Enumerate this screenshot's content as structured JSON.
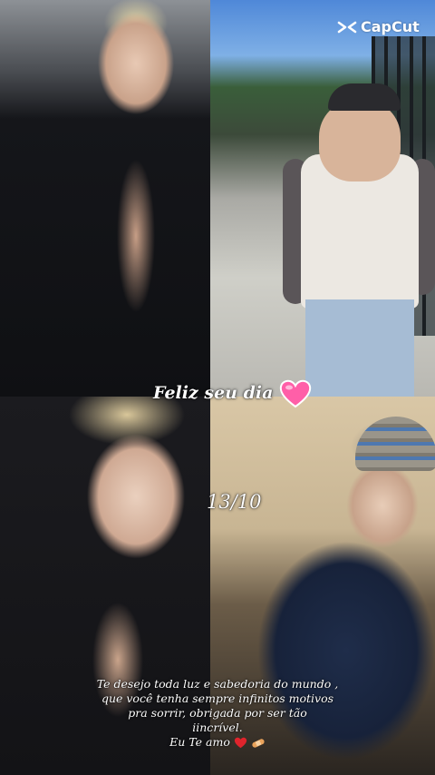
{
  "watermark": {
    "label": "CapCut",
    "icon": "capcut-logo-icon"
  },
  "greeting": {
    "text": "Feliz seu dia",
    "icon": "pink-heart-icon"
  },
  "date": "13/10",
  "message": {
    "lines": [
      "Te desejo toda luz e sabedoria do mundo ,",
      "que você tenha sempre infinitos motivos",
      "pra sorrir, obrigada por ser tão",
      "iincrível.",
      "Eu Te amo"
    ],
    "icons": [
      "red-heart-icon",
      "bandage-icon"
    ]
  },
  "colors": {
    "heart_pink": "#ff5fa8",
    "heart_red": "#e0242c",
    "text": "#ffffff"
  }
}
